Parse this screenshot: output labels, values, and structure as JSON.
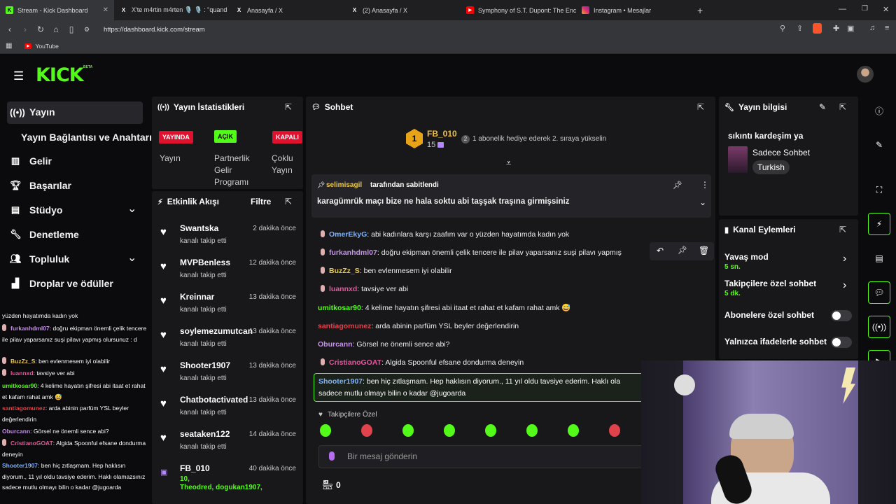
{
  "browser": {
    "tabs": [
      {
        "title": "Stream - Kick Dashboard",
        "close": "✕"
      },
      {
        "title": "X'te m4rtin m4rten 🎙️ 🎙️ : \"quand"
      },
      {
        "title": "Anasayfa / X"
      },
      {
        "title": "(2) Anasayfa / X"
      },
      {
        "title": "Symphony of S.T. Dupont: The Encha"
      },
      {
        "title": "Instagram • Mesajlar"
      }
    ],
    "new_tab": "+",
    "url": "https://dashboard.kick.com/stream",
    "bookmark": "YouTube"
  },
  "brand": {
    "logo": "KICK",
    "beta": "BETA"
  },
  "sidebar": {
    "items": [
      {
        "label": "Yayın",
        "icon": "broadcast-icon"
      },
      {
        "label": "Yayın Bağlantısı ve Anahtarı"
      },
      {
        "label": "Gelir",
        "icon": "chart-icon"
      },
      {
        "label": "Başarılar",
        "icon": "trophy-icon"
      },
      {
        "label": "Stüdyo",
        "icon": "studio-icon",
        "chevron": "⌄"
      },
      {
        "label": "Denetleme",
        "icon": "wrench-icon"
      },
      {
        "label": "Topluluk",
        "icon": "people-icon",
        "chevron": "⌄"
      },
      {
        "label": "Droplar ve ödüller",
        "icon": "podium-icon"
      }
    ]
  },
  "overlay_chat": [
    {
      "text": "yüzden hayatımda kadın yok"
    },
    {
      "user": "furkanhdml07",
      "text": ": doğru ekipman önemli çelik tencere ile pilav yaparsanız suşi pilavı yapmış olursunuz : d",
      "color": "#e8e8e8"
    },
    {
      "user": "BuzZz_S",
      "text": ": ben evlenmesem iyi olabilir",
      "color": "#e8c84a"
    },
    {
      "user": "luannxd",
      "text": ": tavsiye ver abi",
      "color": "#e05a9c"
    },
    {
      "user": "umitkosar90",
      "text": ": 4 kelime hayatın şifresi abi itaat et rahat et kafam rahat amk 😅",
      "color": "#53fc18"
    },
    {
      "user": "santiagomunez",
      "text": ": arda abinin parfüm YSL beyler değerlendirin",
      "color": "#e0434b"
    },
    {
      "user": "Oburcann",
      "text": ": Görsel ne önemli sence abi?",
      "color": "#c792ea"
    },
    {
      "user": "CristianoGOAT",
      "text": ": Algida Spoonful efsane dondurma deneyin",
      "color": "#e05a9c"
    },
    {
      "user": "Shooter1907",
      "text": ": ben hiç zıtlaşmam. Hep haklısın diyorum., 11 yıl oldu tavsiye ederim. Haklı olamazsınız sadece mutlu olmayı bilin o kadar @jugoarda",
      "color": "#7db4ff"
    }
  ],
  "stats": {
    "title": "Yayın İstatistikleri",
    "badges": [
      {
        "text": "YAYINDA",
        "label": "Yayın",
        "bg": "#e0102f"
      },
      {
        "text": "AÇIK",
        "label": "Partnerlik Gelir Programı",
        "bg": "#53fc18"
      },
      {
        "text": "KAPALI",
        "label": "Çoklu Yayın",
        "bg": "#e0102f"
      }
    ]
  },
  "activity": {
    "title": "Etkinlik Akışı",
    "filter": "Filtre",
    "items": [
      {
        "name": "Swantska",
        "sub": "kanalı takip etti",
        "time": "2 dakika önce"
      },
      {
        "name": "MVPBenless",
        "sub": "kanalı takip etti",
        "time": "12 dakika önce"
      },
      {
        "name": "Kreinnar",
        "sub": "kanalı takip etti",
        "time": "13 dakika önce"
      },
      {
        "name": "soylemezumutcan",
        "sub": "kanalı takip etti",
        "time": "13 dakika önce"
      },
      {
        "name": "Shooter1907",
        "sub": "kanalı takip etti",
        "time": "13 dakika önce"
      },
      {
        "name": "Chatbotactivated",
        "sub": "kanalı takip etti",
        "time": "13 dakika önce"
      },
      {
        "name": "seataken122",
        "sub": "kanalı takip etti",
        "time": "14 dakika önce"
      },
      {
        "name": "FB_010",
        "sub": "10,",
        "time": "40 dakika önce",
        "extra": "Theodred, dogukan1907,"
      }
    ]
  },
  "chat": {
    "title": "Sohbet",
    "top_gifter": {
      "rank": "1",
      "name": "FB_010",
      "count": "15",
      "hint_rank": "2",
      "hint": "1 abonelik hediye ederek 2. sıraya yükselin"
    },
    "pinned": {
      "by": "selimisagil",
      "by_suffix": "tarafından sabitlendi",
      "text": "karagümrük maçı bize ne hala soktu abi taşşak traşına girmişsiniz"
    },
    "messages": [
      {
        "user": "OmerEkyG",
        "text": ": abi kadınlara karşı zaafım var o yüzden hayatımda kadın yok",
        "color": "#7db4ff"
      },
      {
        "user": "furkanhdml07",
        "text": ": doğru ekipman önemli çelik tencere ile pilav yaparsanız suşi pilavı yapmış",
        "color": "#c792ea"
      },
      {
        "user": "BuzZz_S",
        "text": ": ben evlenmesem iyi olabilir",
        "color": "#e8c84a"
      },
      {
        "user": "luannxd",
        "text": ": tavsiye ver abi",
        "color": "#e05a9c"
      },
      {
        "user": "umitkosar90",
        "text": ": 4 kelime hayatın şifresi abi itaat et rahat et kafam rahat amk 😅",
        "color": "#53fc18"
      },
      {
        "user": "santiagomunez",
        "text": ": arda abinin parfüm YSL beyler değerlendirin",
        "color": "#e0434b"
      },
      {
        "user": "Oburcann",
        "text": ": Görsel ne önemli sence abi?",
        "color": "#c792ea"
      },
      {
        "user": "CristianoGOAT",
        "text": ": Algida Spoonful efsane dondurma deneyin",
        "color": "#e05a9c"
      }
    ],
    "highlight": {
      "user": "Shooter1907",
      "text": ": ben hiç zıtlaşmam. Hep haklısın diyorum., 11 yıl oldu tavsiye ederim. Haklı ola",
      "line2": "sadece mutlu olmayı bilin o kadar @jugoarda"
    },
    "emote_section": "Takipçilere Özel",
    "input_placeholder": "Bir mesaj gönderin",
    "points": "0"
  },
  "stream_info": {
    "title": "Yayın bilgisi",
    "stream_title": "sıkıntı kardeşim ya",
    "category": "Sadece Sohbet",
    "language": "Turkish"
  },
  "channel_actions": {
    "title": "Kanal Eylemleri",
    "items": [
      {
        "label": "Yavaş mod",
        "value": "5 sn."
      },
      {
        "label": "Takipçilere özel sohbet",
        "value": "5 dk."
      },
      {
        "label": "Abonelere özel sohbet"
      },
      {
        "label": "Yalnızca ifadelerle sohbet"
      }
    ]
  },
  "colors": {
    "accent": "#53fc18",
    "live": "#e0102f",
    "panel": "#18181b"
  }
}
